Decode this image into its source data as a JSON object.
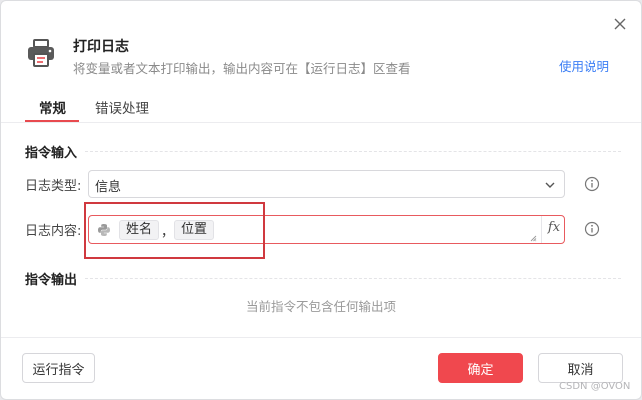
{
  "dialog": {
    "title": "打印日志",
    "subtitle": "将变量或者文本打印输出，输出内容可在【运行日志】区查看",
    "help_link": "使用说明"
  },
  "tabs": [
    {
      "label": "常规",
      "active": true
    },
    {
      "label": "错误处理",
      "active": false
    }
  ],
  "input_section": {
    "title": "指令输入",
    "log_type": {
      "label": "日志类型:",
      "value": "信息"
    },
    "log_content": {
      "label": "日志内容:",
      "tags": [
        "姓名",
        "位置"
      ],
      "separator": "，",
      "fx_label": "fx"
    }
  },
  "output_section": {
    "title": "指令输出",
    "empty_text": "当前指令不包含任何输出项"
  },
  "footer": {
    "run_label": "运行指令",
    "ok_label": "确定",
    "cancel_label": "取消"
  },
  "watermark": "CSDN @OVON",
  "colors": {
    "accent": "#f0484e",
    "link": "#3b7ef5",
    "highlight": "#d0393f"
  },
  "icons": {
    "header": "printer-icon",
    "close": "close-icon",
    "dropdown": "chevron-down-icon",
    "info": "info-icon",
    "python": "python-icon",
    "resize": "resize-grip-icon"
  }
}
